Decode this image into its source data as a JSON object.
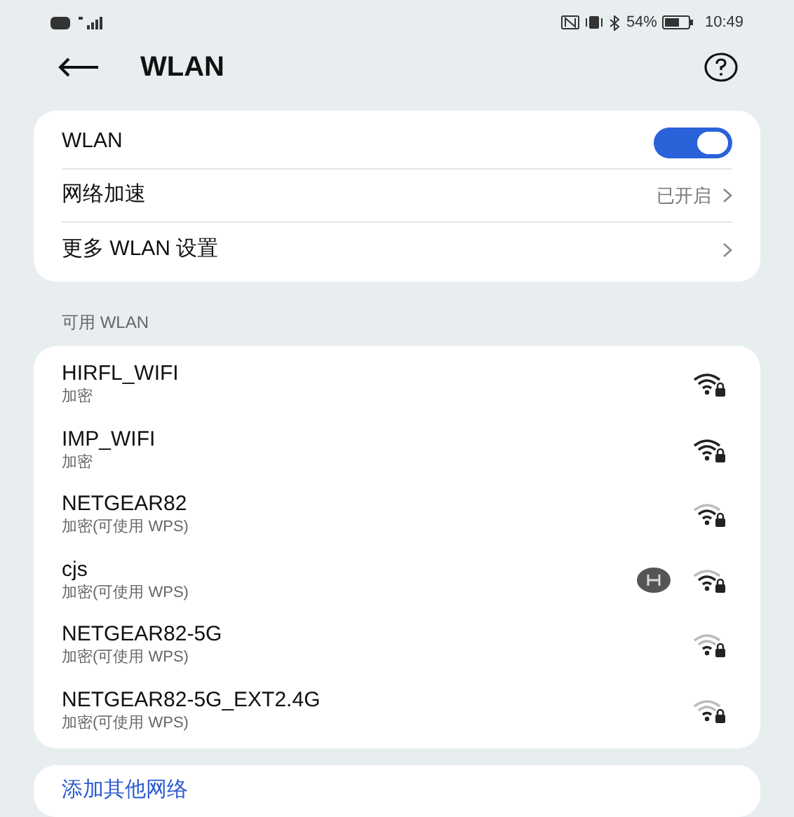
{
  "status_bar": {
    "battery": "54%",
    "time": "10:49"
  },
  "header": {
    "title": "WLAN"
  },
  "settings": [
    {
      "kind": "toggle",
      "label": "WLAN",
      "on": true
    },
    {
      "kind": "link",
      "label": "网络加速",
      "value": "已开启"
    },
    {
      "kind": "link",
      "label": "更多 WLAN 设置"
    }
  ],
  "available_header": "可用 WLAN",
  "networks": [
    {
      "name": "HIRFL_WIFI",
      "security": "加密",
      "kind": "strong",
      "hilink": false
    },
    {
      "name": "IMP_WIFI",
      "security": "加密",
      "kind": "strong",
      "hilink": false
    },
    {
      "name": "NETGEAR82",
      "security": "加密(可使用 WPS)",
      "kind": "medium",
      "hilink": false
    },
    {
      "name": "cjs",
      "security": "加密(可使用 WPS)",
      "kind": "medium",
      "hilink": true
    },
    {
      "name": "NETGEAR82-5G",
      "security": "加密(可使用 WPS)",
      "kind": "weak",
      "hilink": false
    },
    {
      "name": "NETGEAR82-5G_EXT2.4G",
      "security": "加密(可使用 WPS)",
      "kind": "weak",
      "hilink": false
    }
  ],
  "add_network": "添加其他网络"
}
